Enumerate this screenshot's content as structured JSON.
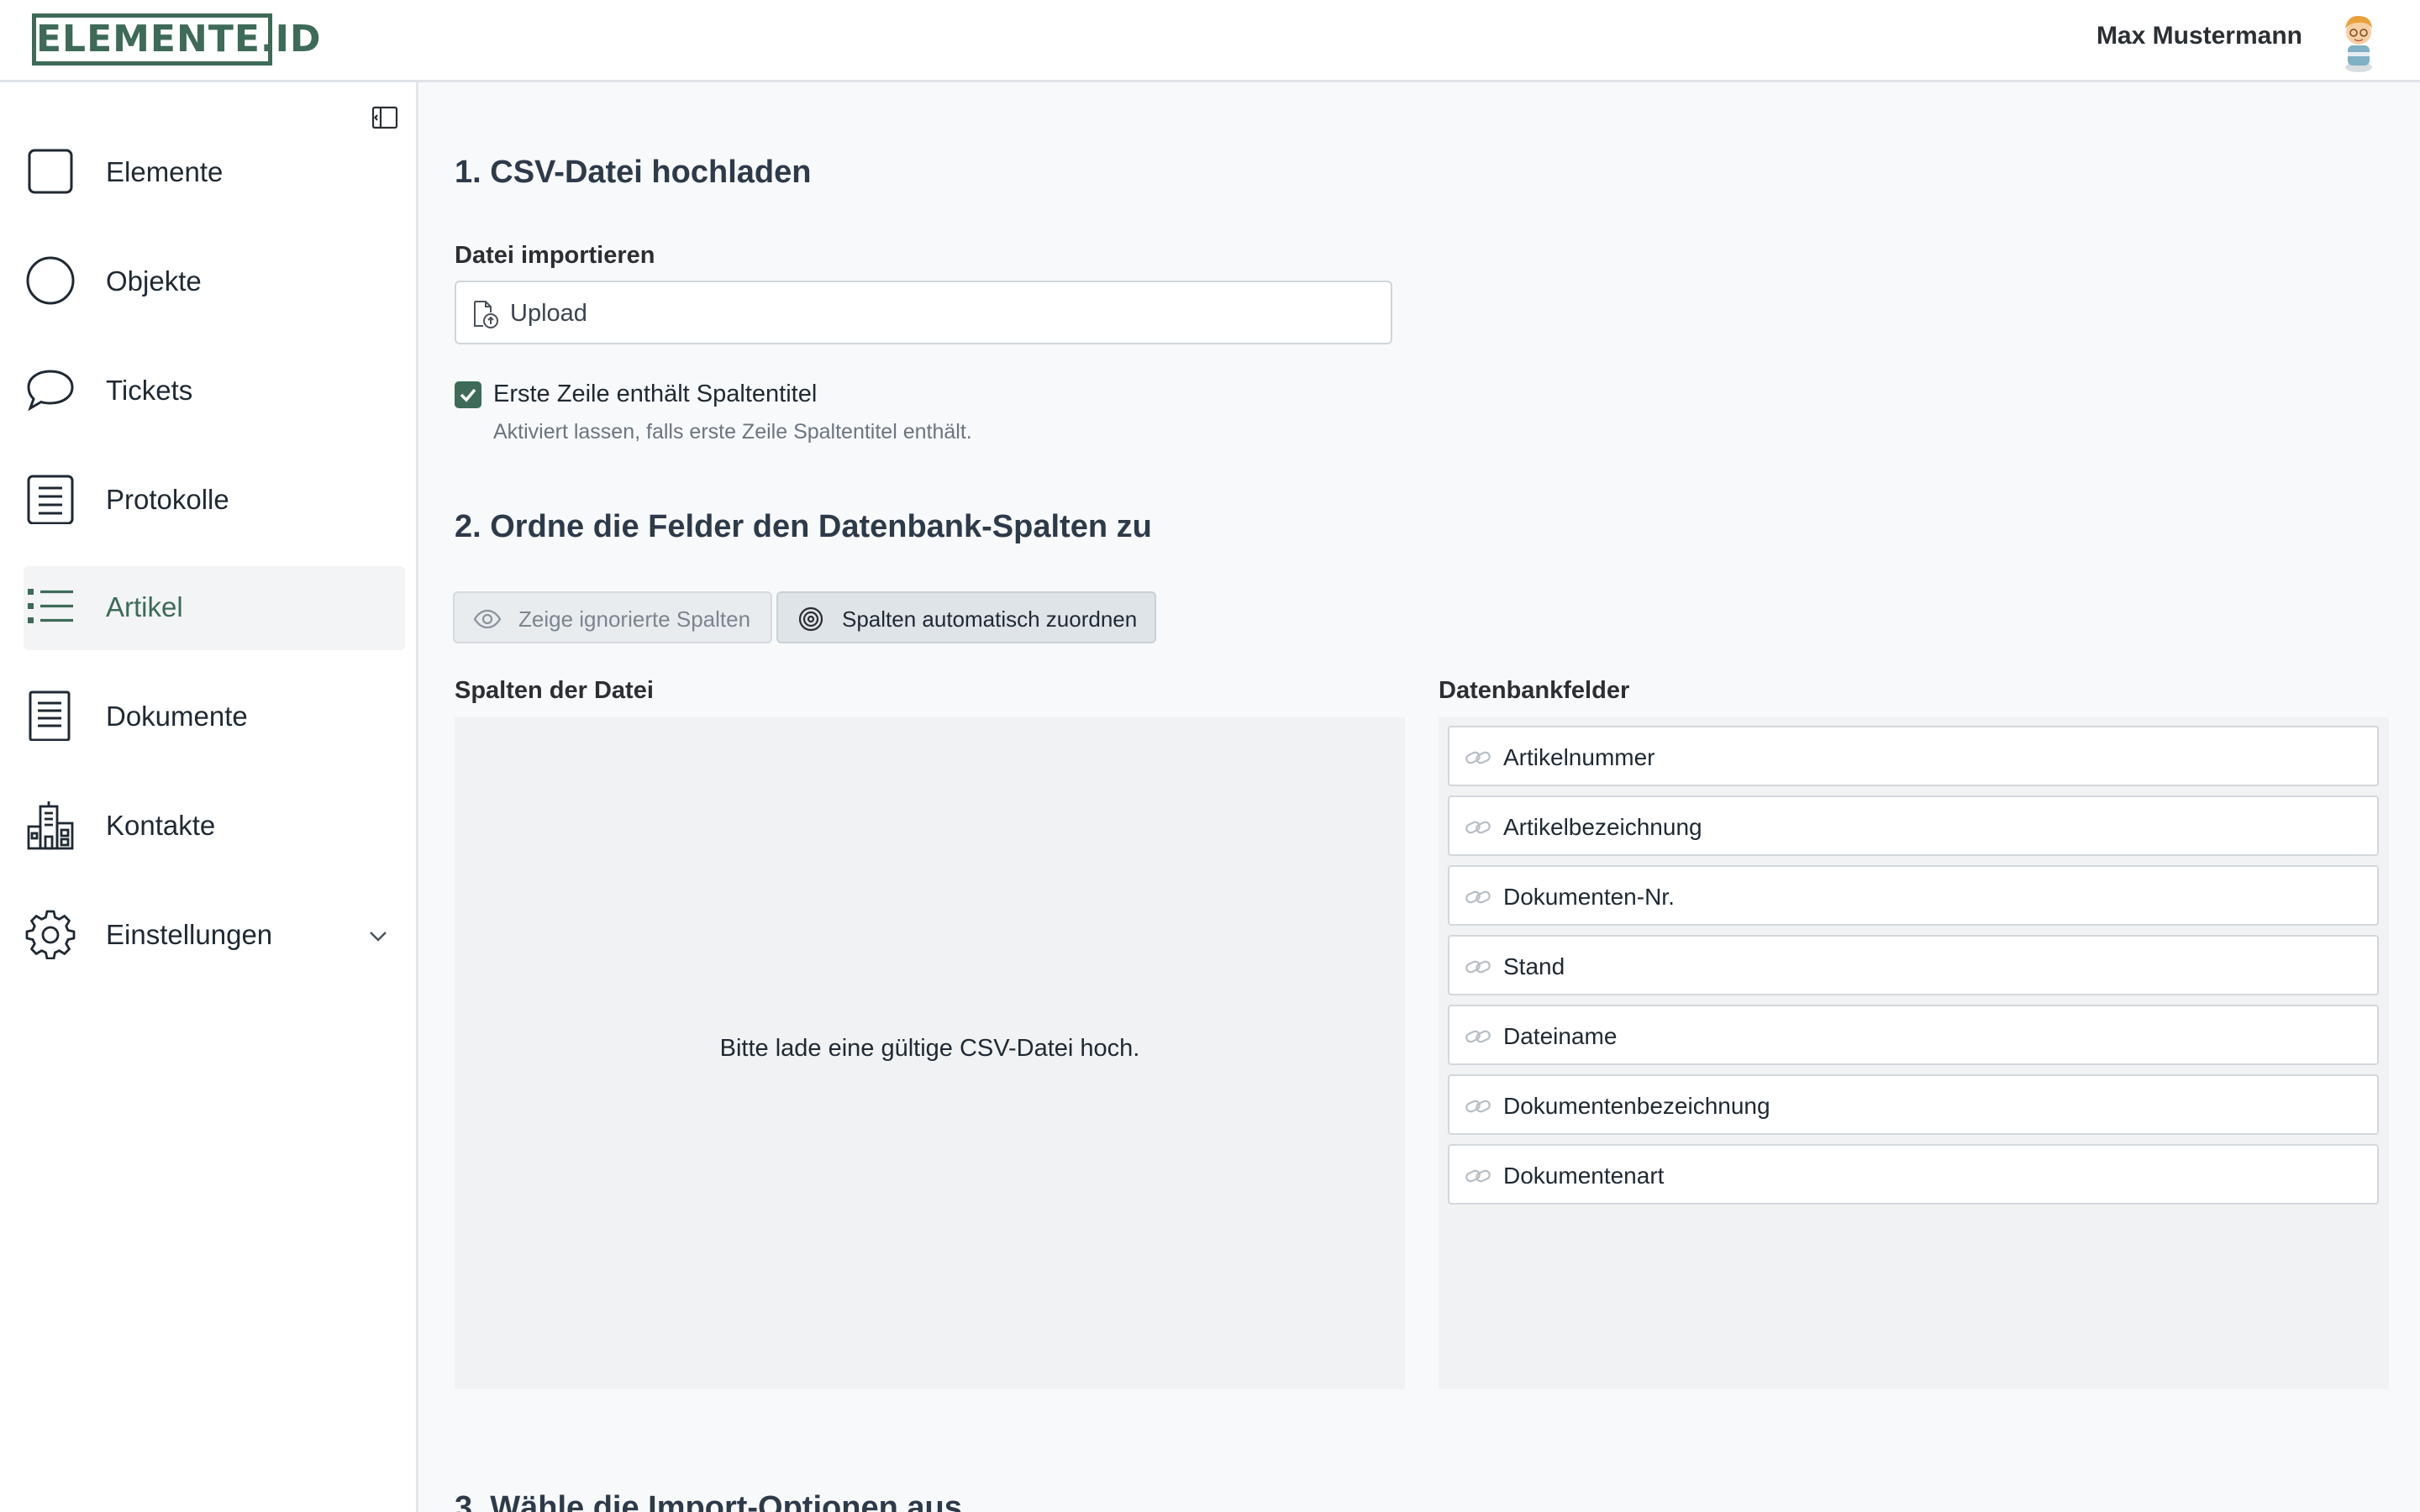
{
  "header": {
    "logo_text": "ELEMENTE.ID",
    "user_name": "Max Mustermann"
  },
  "sidebar": {
    "items": [
      {
        "label": "Elemente",
        "icon": "square-icon"
      },
      {
        "label": "Objekte",
        "icon": "circle-icon"
      },
      {
        "label": "Tickets",
        "icon": "speech-bubble-icon"
      },
      {
        "label": "Protokolle",
        "icon": "document-lines-icon"
      },
      {
        "label": "Artikel",
        "icon": "list-icon",
        "active": true
      },
      {
        "label": "Dokumente",
        "icon": "document-icon"
      },
      {
        "label": "Kontakte",
        "icon": "buildings-icon"
      },
      {
        "label": "Einstellungen",
        "icon": "gear-icon",
        "has_submenu": true
      }
    ]
  },
  "main": {
    "section1_title": "1. CSV-Datei hochladen",
    "import_label": "Datei importieren",
    "upload_value": "Upload",
    "header_row_checkbox": {
      "label": "Erste Zeile enthält Spaltentitel",
      "help": "Aktiviert lassen, falls erste Zeile Spaltentitel enthält.",
      "checked": true
    },
    "section2_title": "2. Ordne die Felder den Datenbank-Spalten zu",
    "buttons": {
      "show_ignored": "Zeige ignorierte Spalten",
      "auto_assign": "Spalten automatisch zuordnen"
    },
    "file_columns_label": "Spalten der Datei",
    "file_columns_empty": "Bitte lade eine gültige CSV-Datei hoch.",
    "db_fields_label": "Datenbankfelder",
    "db_fields": [
      "Artikelnummer",
      "Artikelbezeichnung",
      "Dokumenten-Nr.",
      "Stand",
      "Dateiname",
      "Dokumentenbezeichnung",
      "Dokumentenart"
    ],
    "section3_title": "3. Wähle die Import-Optionen aus"
  },
  "colors": {
    "brand": "#3d6b58",
    "sidebar_active_bg": "#f2f4f5",
    "panel_bg": "#f0f2f4"
  }
}
